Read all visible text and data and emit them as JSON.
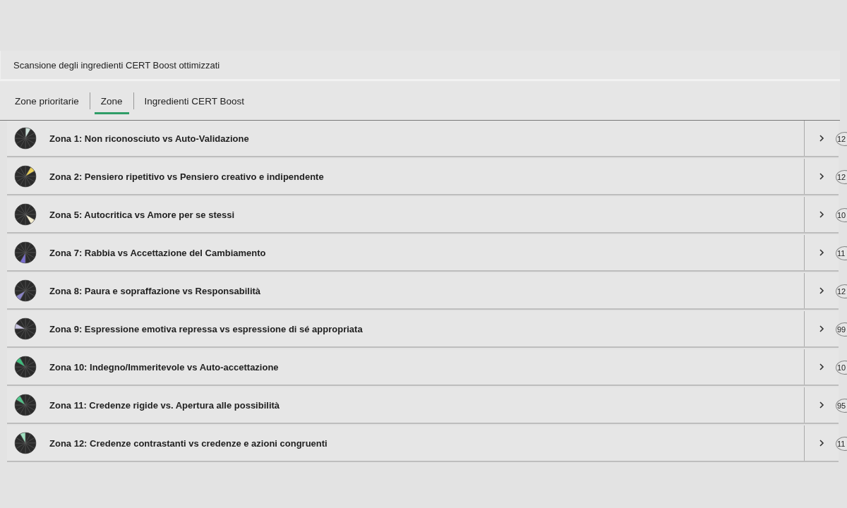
{
  "header": {
    "title": "Scansione degli ingredienti CERT Boost ottimizzati"
  },
  "tabs": [
    {
      "label": "Zone prioritarie",
      "selected": false
    },
    {
      "label": "Zone",
      "selected": true
    },
    {
      "label": "Ingredienti CERT Boost",
      "selected": false
    }
  ],
  "zones": [
    {
      "title": "Zona 1: Non riconosciuto vs Auto-Validazione",
      "color": "#cfe3dc",
      "count": "12"
    },
    {
      "title": "Zona 2: Pensiero ripetitivo vs Pensiero creativo e indipendente",
      "color": "#e8cf5a",
      "count": "12"
    },
    {
      "title": "Zona 5: Autocritica vs Amore per se stessi",
      "color": "#f3ecd0",
      "count": "10"
    },
    {
      "title": "Zona 7: Rabbia vs Accettazione del Cambiamento",
      "color": "#7b6fd0",
      "count": "11"
    },
    {
      "title": "Zona 8: Paura e sopraffazione vs Responsabilità",
      "color": "#8a84c8",
      "count": "12"
    },
    {
      "title": "Zona 9: Espressione emotiva repressa vs espressione di sé appropriata",
      "color": "#c8c4e0",
      "count": "99"
    },
    {
      "title": "Zona 10: Indegno/Immeritevole vs Auto-accettazione",
      "color": "#3dbd7d",
      "count": "10"
    },
    {
      "title": "Zona 11: Credenze rigide vs. Apertura alle possibilità",
      "color": "#52c48a",
      "count": "95"
    },
    {
      "title": "Zona 12: Credenze contrastanti vs credenze e azioni congruenti",
      "color": "#9fe0c0",
      "count": "11"
    }
  ]
}
